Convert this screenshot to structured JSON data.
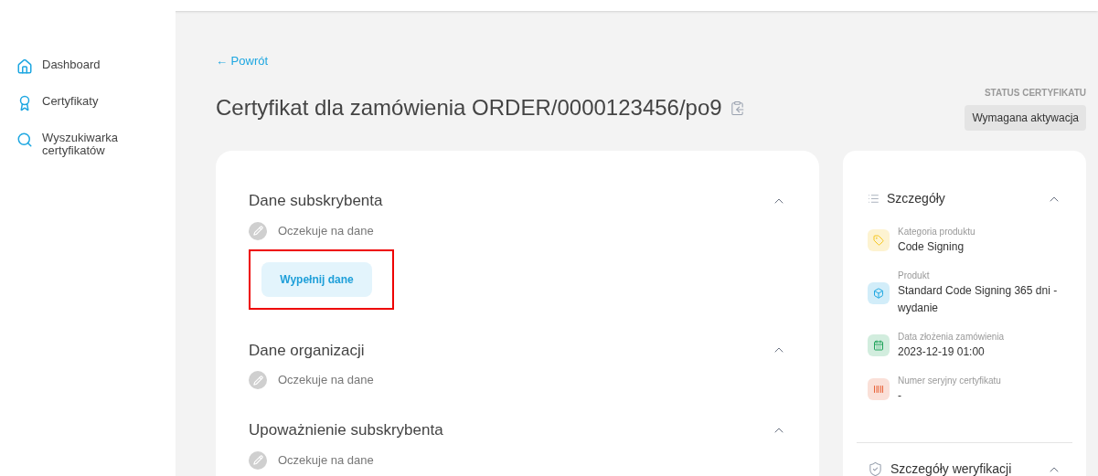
{
  "sidebar": {
    "items": [
      {
        "label": "Dashboard",
        "kind": "home"
      },
      {
        "label": "Certyfikaty",
        "kind": "award"
      },
      {
        "label": "Wyszukiwarka certyfikatów",
        "kind": "search"
      }
    ]
  },
  "back_link": "← Powrót",
  "page_title": "Certyfikat dla zamówienia ORDER/0000123456/po9",
  "status": {
    "label": "STATUS CERTYFIKATU",
    "value": "Wymagana aktywacja"
  },
  "sections": [
    {
      "title": "Dane subskrybenta",
      "status": "Oczekuje na dane",
      "expanded": true,
      "button": "Wypełnij dane",
      "highlighted": true
    },
    {
      "title": "Dane organizacji",
      "status": "Oczekuje na dane",
      "expanded": true
    },
    {
      "title": "Upoważnienie subskrybenta",
      "status": "Oczekuje na dane",
      "expanded": true
    }
  ],
  "details": {
    "title": "Szczegóły",
    "expanded": true,
    "items": [
      {
        "kind": "tag",
        "color": "#f5c518",
        "label": "Kategoria produktu",
        "value": "Code Signing"
      },
      {
        "kind": "box",
        "color": "#1ea7e1",
        "label": "Produkt",
        "value": "Standard Code Signing 365 dni - wydanie"
      },
      {
        "kind": "calendar",
        "color": "#1fa35a",
        "label": "Data złożenia zamówienia",
        "value": "2023-12-19 01:00"
      },
      {
        "kind": "serial",
        "color": "#e8643a",
        "label": "Numer seryjny certyfikatu",
        "value": "-"
      }
    ]
  },
  "verification": {
    "title": "Szczegóły weryfikacji",
    "expanded": true
  }
}
